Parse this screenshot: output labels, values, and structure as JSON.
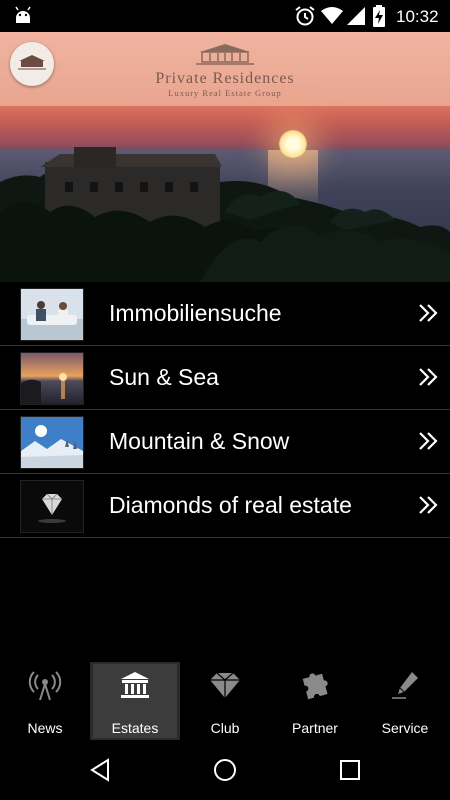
{
  "status_bar": {
    "time": "10:32",
    "icons": [
      "android-icon",
      "alarm-icon",
      "wifi-icon",
      "cell-signal-icon",
      "battery-charging-icon"
    ]
  },
  "header": {
    "brand_title": "Private Residences",
    "brand_subtitle": "Luxury Real Estate Group"
  },
  "menu": {
    "items": [
      {
        "label": "Immobiliensuche",
        "thumb": "people-on-couch"
      },
      {
        "label": "Sun & Sea",
        "thumb": "sunset-sea"
      },
      {
        "label": "Mountain & Snow",
        "thumb": "snowy-mountains"
      },
      {
        "label": "Diamonds of real estate",
        "thumb": "diamond"
      }
    ]
  },
  "bottom_nav": {
    "active": "Estates",
    "tabs": [
      {
        "label": "News",
        "icon": "broadcast-icon"
      },
      {
        "label": "Estates",
        "icon": "building-icon"
      },
      {
        "label": "Club",
        "icon": "diamond-icon"
      },
      {
        "label": "Partner",
        "icon": "puzzle-icon"
      },
      {
        "label": "Service",
        "icon": "pen-icon"
      }
    ]
  }
}
